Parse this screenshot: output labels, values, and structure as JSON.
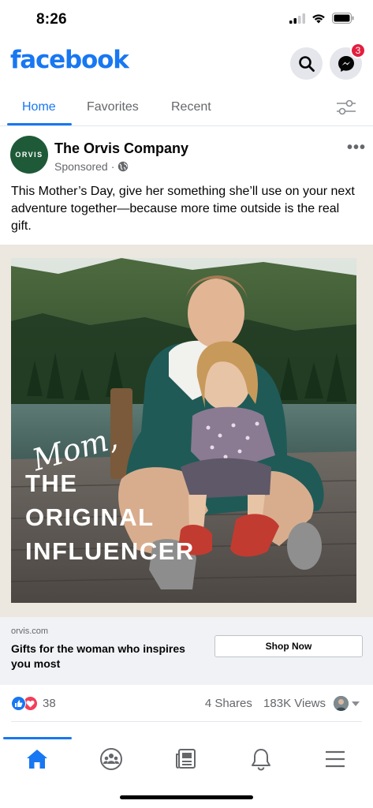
{
  "status_bar": {
    "time": "8:26"
  },
  "header": {
    "logo": "facebook",
    "messenger_badge": "3",
    "brand_color": "#1877f2"
  },
  "tabs": [
    {
      "label": "Home",
      "active": true
    },
    {
      "label": "Favorites",
      "active": false
    },
    {
      "label": "Recent",
      "active": false
    }
  ],
  "post": {
    "avatar_text": "ORVIS",
    "page_name": "The Orvis Company",
    "sponsored_label": "Sponsored",
    "separator": "·",
    "text": "This Mother’s Day, give her something she’ll use on your next adventure together—because more time outside is the real gift.",
    "image_overlay": {
      "script": "Mom,",
      "lines": [
        "THE",
        "ORIGINAL",
        "INFLUENCER"
      ]
    }
  },
  "cta": {
    "domain": "orvis.com",
    "headline": "Gifts for the woman who inspires you most",
    "button": "Shop Now"
  },
  "engagement": {
    "reaction_count": "38",
    "shares": "4 Shares",
    "views": "183K Views"
  },
  "bottom_nav": [
    "home-icon",
    "groups-icon",
    "news-icon",
    "bell-icon",
    "menu-icon"
  ]
}
